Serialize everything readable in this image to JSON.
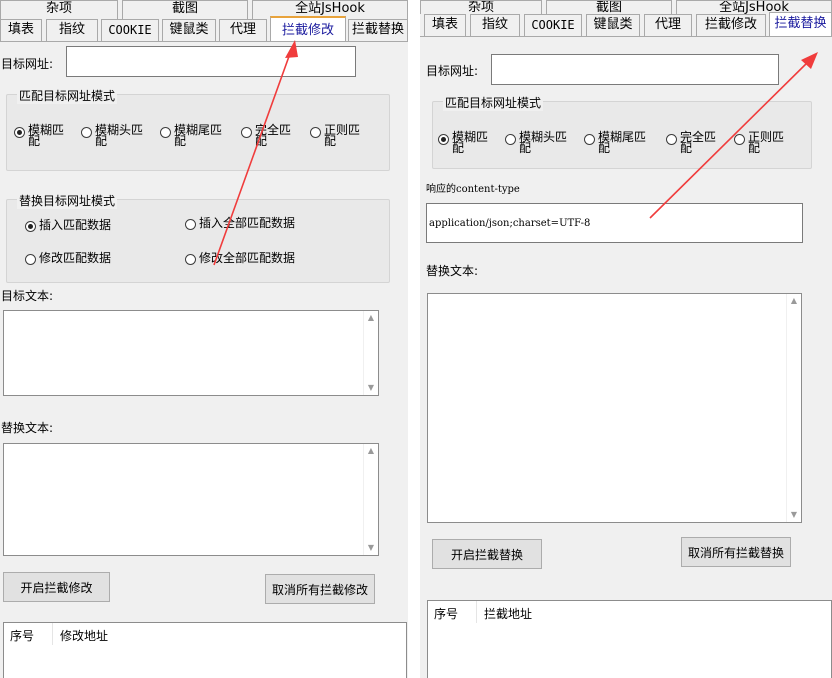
{
  "left": {
    "top_tabs": [
      "杂项",
      "截图",
      "全站JsHook"
    ],
    "tabs": [
      "填表",
      "指纹",
      "COOKIE",
      "键鼠类",
      "代理",
      "拦截修改",
      "拦截替换"
    ],
    "active_tab": "拦截修改",
    "target_url_label": "目标网址:",
    "target_url_value": "",
    "match_group": {
      "title": "匹配目标网址模式",
      "options": [
        "模糊匹配",
        "模糊头匹配",
        "模糊尾匹配",
        "完全匹配",
        "正则匹配"
      ],
      "selected": "模糊匹配"
    },
    "replace_group": {
      "title": "替换目标网址模式",
      "options": [
        "插入匹配数据",
        "插入全部匹配数据",
        "修改匹配数据",
        "修改全部匹配数据"
      ],
      "selected": "插入匹配数据"
    },
    "target_text_label": "目标文本:",
    "replace_text_label": "替换文本:",
    "start_button": "开启拦截修改",
    "cancel_button": "取消所有拦截修改",
    "list_columns": [
      "序号",
      "修改地址"
    ]
  },
  "right": {
    "top_tabs": [
      "杂项",
      "截图",
      "全站JsHook"
    ],
    "tabs": [
      "填表",
      "指纹",
      "COOKIE",
      "键鼠类",
      "代理",
      "拦截修改",
      "拦截替换"
    ],
    "active_tab": "拦截替换",
    "target_url_label": "目标网址:",
    "target_url_value": "",
    "match_group": {
      "title": "匹配目标网址模式",
      "options": [
        "模糊匹配",
        "模糊头匹配",
        "模糊尾匹配",
        "完全匹配",
        "正则匹配"
      ],
      "selected": "模糊匹配"
    },
    "content_type_label": "响应的content-type",
    "content_type_value": "application/json;charset=UTF-8",
    "replace_text_label": "替换文本:",
    "start_button": "开启拦截替换",
    "cancel_button": "取消所有拦截替换",
    "list_columns": [
      "序号",
      "拦截地址"
    ]
  },
  "colors": {
    "panel_bg": "#f0f0f0",
    "active_tab_text": "#1a1a9e",
    "annotation_arrow": "#f03c3c"
  },
  "icons": [
    "radio-checked",
    "radio-unchecked",
    "scroll-up-arrow",
    "scroll-down-arrow",
    "annotation-arrow"
  ]
}
